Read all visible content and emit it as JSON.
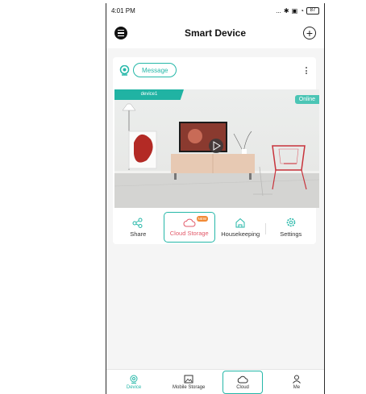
{
  "status_bar": {
    "time": "4:01 PM",
    "dots": "...",
    "battery": "87"
  },
  "header": {
    "title": "Smart Device"
  },
  "card": {
    "message_label": "Message",
    "device_name": "device1",
    "status": "Online"
  },
  "actions": [
    {
      "label": "Share",
      "icon": "share-icon"
    },
    {
      "label": "Cloud Storage",
      "icon": "cloud-icon",
      "badge": "NEW"
    },
    {
      "label": "Housekeeping",
      "icon": "home-icon"
    },
    {
      "label": "Settings",
      "icon": "gear-icon"
    }
  ],
  "tabbar": [
    {
      "label": "Device",
      "icon": "device-icon"
    },
    {
      "label": "Mobile Storage",
      "icon": "image-icon"
    },
    {
      "label": "Cloud",
      "icon": "cloud-icon"
    },
    {
      "label": "Me",
      "icon": "user-icon"
    }
  ],
  "colors": {
    "accent": "#25b7a8",
    "highlight_text": "#e25a6a",
    "badge": "#f28a36"
  }
}
